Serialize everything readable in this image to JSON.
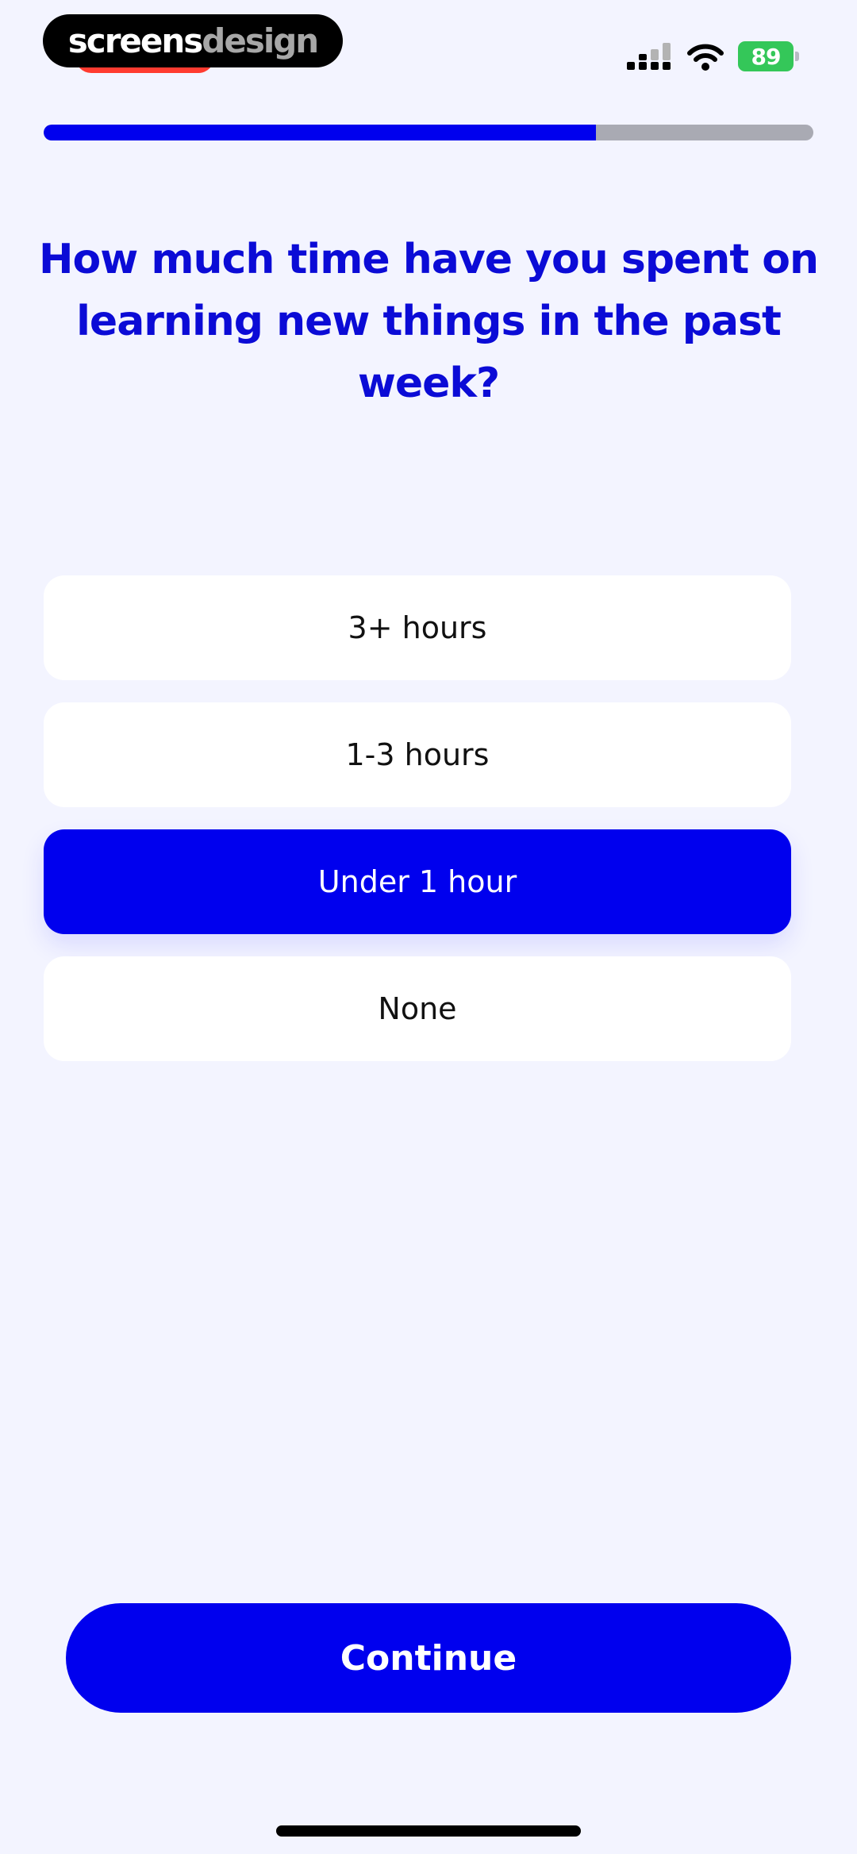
{
  "watermark": {
    "part1": "screens",
    "part2": "design"
  },
  "status_bar": {
    "battery_level": "89",
    "battery_color": "#34c759",
    "icons": [
      "cellular-signal-icon",
      "wifi-icon",
      "battery-charging-icon"
    ]
  },
  "progress": {
    "fraction": 0.718
  },
  "question": {
    "text": "How much time have you spent on learning new things in the past week?"
  },
  "options": [
    {
      "label": "3+ hours",
      "selected": false
    },
    {
      "label": "1-3 hours",
      "selected": false
    },
    {
      "label": "Under 1 hour",
      "selected": true
    },
    {
      "label": "None",
      "selected": false
    }
  ],
  "continue_button": {
    "label": "Continue"
  },
  "colors": {
    "background": "#f3f4ff",
    "accent": "#0000ee",
    "progress_track": "#a9aab3",
    "option_background": "#ffffff",
    "option_text": "#111111",
    "selected_text": "#ffffff",
    "question_text": "#0b0bd6"
  }
}
